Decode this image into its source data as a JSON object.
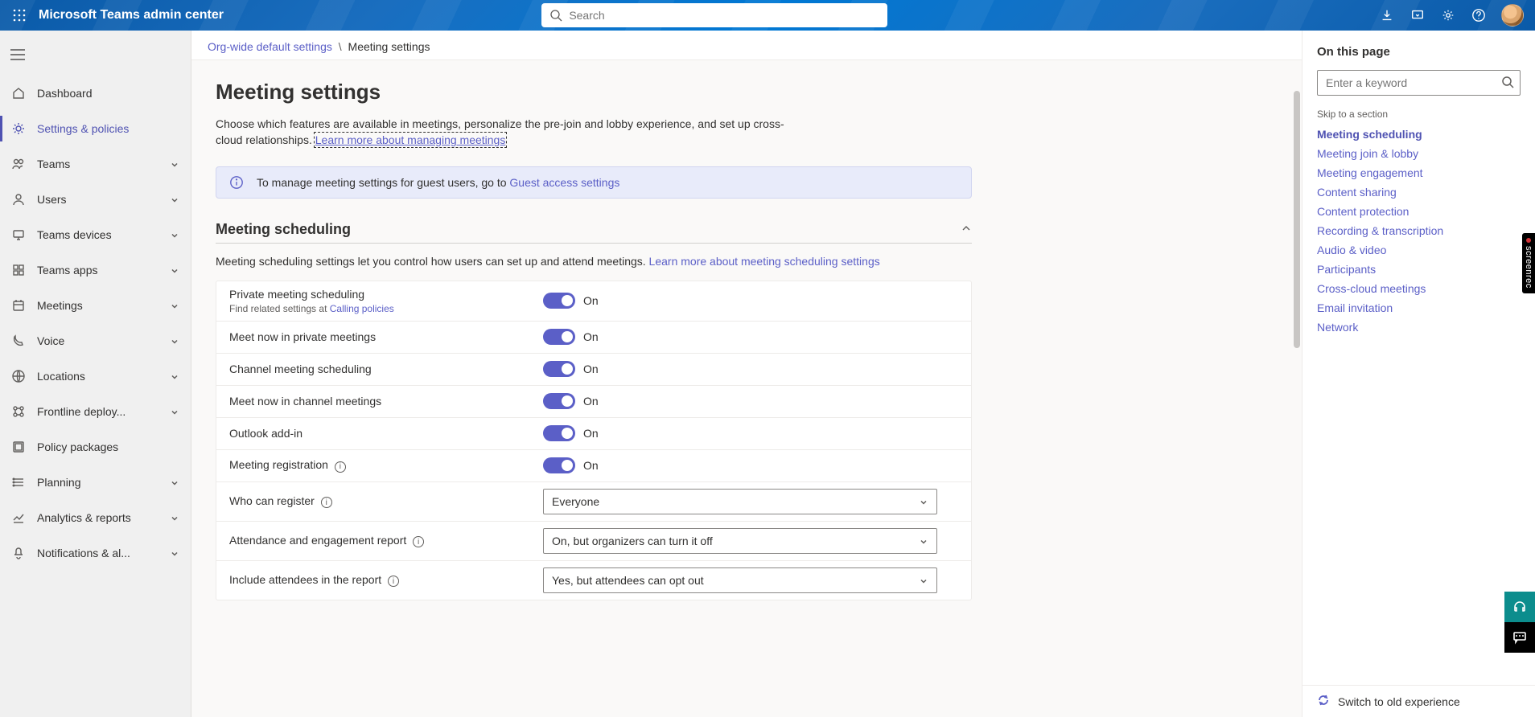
{
  "header": {
    "brand": "Microsoft Teams admin center",
    "search_placeholder": "Search"
  },
  "sidebar": {
    "items": [
      {
        "label": "Dashboard",
        "expandable": false,
        "active": false
      },
      {
        "label": "Settings & policies",
        "expandable": false,
        "active": true
      },
      {
        "label": "Teams",
        "expandable": true,
        "active": false
      },
      {
        "label": "Users",
        "expandable": true,
        "active": false
      },
      {
        "label": "Teams devices",
        "expandable": true,
        "active": false
      },
      {
        "label": "Teams apps",
        "expandable": true,
        "active": false
      },
      {
        "label": "Meetings",
        "expandable": true,
        "active": false
      },
      {
        "label": "Voice",
        "expandable": true,
        "active": false
      },
      {
        "label": "Locations",
        "expandable": true,
        "active": false
      },
      {
        "label": "Frontline deploy...",
        "expandable": true,
        "active": false
      },
      {
        "label": "Policy packages",
        "expandable": false,
        "active": false
      },
      {
        "label": "Planning",
        "expandable": true,
        "active": false
      },
      {
        "label": "Analytics & reports",
        "expandable": true,
        "active": false
      },
      {
        "label": "Notifications & al...",
        "expandable": true,
        "active": false
      }
    ]
  },
  "breadcrumb": {
    "parent": "Org-wide default settings",
    "separator": "\\",
    "current": "Meeting settings"
  },
  "page": {
    "title": "Meeting settings",
    "description_pre": "Choose which features are available in meetings, personalize the pre-join and lobby experience, and set up cross-cloud relationships. ",
    "description_link": "Learn more about managing meetings"
  },
  "infobar": {
    "text_pre": "To manage meeting settings for guest users, go to ",
    "link": "Guest access settings"
  },
  "section": {
    "title": "Meeting scheduling",
    "desc_pre": "Meeting scheduling settings let you control how users can set up and attend meetings. ",
    "desc_link": "Learn more about meeting scheduling settings"
  },
  "toggle_on_label": "On",
  "settings": [
    {
      "type": "toggle",
      "label": "Private meeting scheduling",
      "sublabel_pre": "Find related settings at ",
      "sublabel_link": "Calling policies",
      "on": true
    },
    {
      "type": "toggle",
      "label": "Meet now in private meetings",
      "on": true
    },
    {
      "type": "toggle",
      "label": "Channel meeting scheduling",
      "on": true
    },
    {
      "type": "toggle",
      "label": "Meet now in channel meetings",
      "on": true
    },
    {
      "type": "toggle",
      "label": "Outlook add-in",
      "on": true
    },
    {
      "type": "toggle",
      "label": "Meeting registration",
      "info": true,
      "on": true
    },
    {
      "type": "select",
      "label": "Who can register",
      "info": true,
      "value": "Everyone"
    },
    {
      "type": "select",
      "label": "Attendance and engagement report",
      "info": true,
      "value": "On, but organizers can turn it off"
    },
    {
      "type": "select",
      "label": "Include attendees in the report",
      "info": true,
      "value": "Yes, but attendees can opt out"
    }
  ],
  "rail": {
    "title": "On this page",
    "search_placeholder": "Enter a keyword",
    "skip_label": "Skip to a section",
    "links": [
      {
        "label": "Meeting scheduling",
        "active": true
      },
      {
        "label": "Meeting join & lobby"
      },
      {
        "label": "Meeting engagement"
      },
      {
        "label": "Content sharing"
      },
      {
        "label": "Content protection"
      },
      {
        "label": "Recording & transcription"
      },
      {
        "label": "Audio & video"
      },
      {
        "label": "Participants"
      },
      {
        "label": "Cross-cloud meetings"
      },
      {
        "label": "Email invitation"
      },
      {
        "label": "Network"
      }
    ],
    "switch_label": "Switch to old experience"
  },
  "screenrec_label": "screenrec"
}
